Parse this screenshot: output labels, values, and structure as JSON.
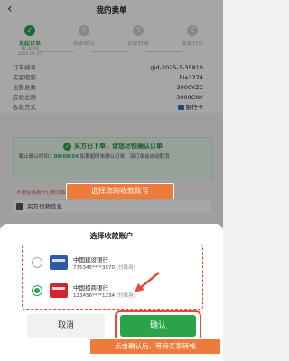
{
  "header": {
    "back_icon": "chevron-left-icon",
    "title": "我的卖单"
  },
  "steps": [
    {
      "label": "发起订单",
      "time": "10:30:06\n2025-04-27",
      "active": true,
      "num": "✓"
    },
    {
      "label": "卖家确认",
      "time": "",
      "active": false,
      "num": "2"
    },
    {
      "label": "买家转账",
      "time": "",
      "active": false,
      "num": "3"
    },
    {
      "label": "卖家打币",
      "time": "",
      "active": false,
      "num": "4"
    }
  ],
  "order_info": [
    {
      "label": "订单编号",
      "value": "gid-2025-3-35816"
    },
    {
      "label": "买家昵称",
      "value": "hie3274"
    },
    {
      "label": "出售总数",
      "value": "3000YZC"
    },
    {
      "label": "应收总额",
      "value": "3000CNY"
    },
    {
      "label": "收款方式",
      "value": "银行卡"
    }
  ],
  "notice": {
    "title": "买方已下单，请您尽快确认订单",
    "text_before": "截止确认时间：",
    "time": "00:09:54",
    "text_after": "如果超时未确认订单，该订单会自动取消"
  },
  "warning": "! 不要轻易离开订单页面",
  "payer_label": "买方付款信息",
  "callout_select": "选择您的收款账号",
  "sheet": {
    "title": "选择收款账户",
    "accounts": [
      {
        "bank": "中国建设银行",
        "number": "775345****3570",
        "tag": "(付款用)",
        "selected": false,
        "logo": "ccb-logo"
      },
      {
        "bank": "中国招商银行",
        "number": "123456****1234",
        "tag": "(付款用)",
        "selected": true,
        "logo": "cmb-logo"
      }
    ],
    "cancel_label": "取消",
    "confirm_label": "确认"
  },
  "hint_confirm": "点击确认后，等待买家转帐",
  "colors": {
    "green": "#2aa34a",
    "orange": "#ee7b3b",
    "red": "#e34c3c"
  }
}
